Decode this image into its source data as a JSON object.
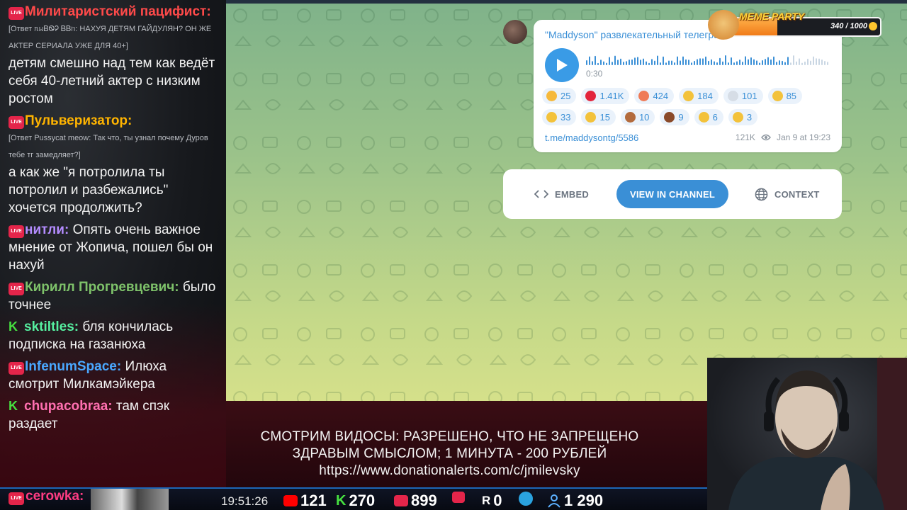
{
  "chat": {
    "messages": [
      {
        "badge": "live",
        "name": "Милитаристский пацифист:",
        "name_color": "#ff4a4a",
        "reply": "[Ответ ᥰᥕᏴᏫᎮ ᏴᏴᥒ: НАХУЯ ДЕТЯМ ГАЙДУЛЯН? ОН ЖЕ АКТЕР СЕРИАЛА УЖЕ ДЛЯ 40+]",
        "text": "детям смешно над тем как ведёт себя 40-летний актер с низким ростом"
      },
      {
        "badge": "live",
        "name": "Пульверизатор:",
        "name_color": "#ffb400",
        "reply": "[Ответ Pussycat meow: Так что, ты узнал почему Дуров тебе тг замедляет?]",
        "text": "а как же \"я потролила ты потролил и разбежались\" хочется продолжить?"
      },
      {
        "badge": "live",
        "name": "нитли:",
        "name_color": "#b48cff",
        "reply": "",
        "text": "Опять очень важное мнение от Жопича, пошел бы он нахуй"
      },
      {
        "badge": "live",
        "name": "Кирилл Прогревцевич:",
        "name_color": "#7ec26a",
        "reply": "",
        "text": "было точнее"
      },
      {
        "badge": "kick",
        "name": "sktiltles:",
        "name_color": "#56f0a0",
        "reply": "",
        "text": "бля кончилась подписка на газанюха"
      },
      {
        "badge": "live",
        "name": "InfenumSpace:",
        "name_color": "#4aa8ff",
        "reply": "",
        "text": "Илюха смотрит Милкамэйкера"
      },
      {
        "badge": "kick",
        "name": "chupacobraa:",
        "name_color": "#ff6fb0",
        "reply": "",
        "text": "там спэк раздает"
      }
    ],
    "live_label": "LIVE"
  },
  "post": {
    "title": "\"Maddyson\" развлекательный телеграм",
    "duration": "0:30",
    "reactions_row1": [
      {
        "icon": "star-icon",
        "color": "#f6b93b",
        "count": "25"
      },
      {
        "icon": "heart-icon",
        "color": "#e3253c",
        "count": "1.41K"
      },
      {
        "icon": "clown-icon",
        "color": "#ef7b57",
        "count": "424"
      },
      {
        "icon": "laugh-icon",
        "color": "#f3c23b",
        "count": "184"
      },
      {
        "icon": "broken-heart-icon",
        "color": "#d6dde6",
        "count": "101"
      },
      {
        "icon": "thumbs-up-icon",
        "color": "#f3c23b",
        "count": "85"
      }
    ],
    "reactions_row2": [
      {
        "icon": "thinking-icon",
        "color": "#f3c23b",
        "count": "33"
      },
      {
        "icon": "clap-icon",
        "color": "#f3c23b",
        "count": "15"
      },
      {
        "icon": "monkey-icon",
        "color": "#b36b3d",
        "count": "10"
      },
      {
        "icon": "poop-icon",
        "color": "#8a4a2a",
        "count": "9"
      },
      {
        "icon": "middle-finger-icon",
        "color": "#f3c23b",
        "count": "6"
      },
      {
        "icon": "thumbs-down-icon",
        "color": "#f3c23b",
        "count": "3"
      }
    ],
    "link": "t.me/maddysontg/5586",
    "views": "121K",
    "date": "Jan 9 at 19:23"
  },
  "actions": {
    "embed": "EMBED",
    "view": "VIEW IN CHANNEL",
    "context": "CONTEXT"
  },
  "meme_party": {
    "title": "MEME PARTY",
    "count": "340 / 1000",
    "progress": 0.34
  },
  "announce": {
    "line1": "СМОТРИМ ВИДОСЫ: РАЗРЕШЕНО, ЧТО НЕ ЗАПРЕЩЕНО",
    "line2": "ЗДРАВЫМ СМЫСЛОМ; 1 МИНУТА - 200 РУБЛЕЙ",
    "line3": "https://www.donationalerts.com/c/jmilevsky"
  },
  "ticker": {
    "name": "cerowka:",
    "time": "19:51:26",
    "youtube": "121",
    "kick": "270",
    "vk": "899",
    "rutube": "0",
    "telegram": "",
    "viewers": "1 290"
  },
  "colors": {
    "accent_blue": "#3a8fd6",
    "live_red": "#e4254a",
    "kick_green": "#46e040"
  }
}
